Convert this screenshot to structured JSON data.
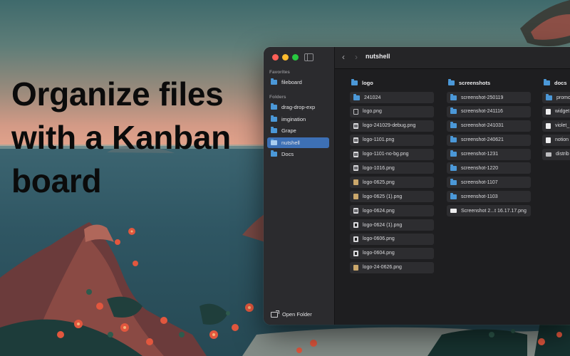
{
  "headline": {
    "line1": "Organize files",
    "line2": "with a Kanban",
    "line3": "board"
  },
  "colors": {
    "accent": "#3d70b5",
    "folder": "#4b98d8",
    "window_bg": "#1e1e20",
    "sidebar_bg": "#2b2b2e"
  },
  "sidebar": {
    "favorites_label": "Favorites",
    "favorites": [
      {
        "label": "fileboard",
        "icon": "folder-icon"
      }
    ],
    "folders_label": "Folders",
    "folders": [
      {
        "label": "drag-drop-exp",
        "icon": "folder-icon"
      },
      {
        "label": "imgination",
        "icon": "folder-icon"
      },
      {
        "label": "Grape",
        "icon": "folder-icon"
      },
      {
        "label": "nutshell",
        "icon": "folder-icon",
        "selected": true
      },
      {
        "label": "Docs",
        "icon": "folder-icon"
      }
    ],
    "open_folder_label": "Open Folder"
  },
  "toolbar": {
    "title": "nutshell",
    "back_icon": "chevron-left-icon",
    "forward_icon": "chevron-right-icon"
  },
  "columns": [
    {
      "title": "logo",
      "items": [
        {
          "label": "241024",
          "icon": "folder-icon"
        },
        {
          "label": "logo.png",
          "icon": "image-file-icon"
        },
        {
          "label": "logo-241029-debug.png",
          "icon": "image-file-icon"
        },
        {
          "label": "logo-1101.png",
          "icon": "image-file-icon"
        },
        {
          "label": "logo-1101-no-bg.png",
          "icon": "image-file-icon"
        },
        {
          "label": "logo-1016.png",
          "icon": "image-file-icon"
        },
        {
          "label": "logo-0625.png",
          "icon": "image-file-icon"
        },
        {
          "label": "logo-0625 (1).png",
          "icon": "image-file-icon"
        },
        {
          "label": "logo-0624.png",
          "icon": "image-file-icon"
        },
        {
          "label": "logo-0624 (1).png",
          "icon": "image-file-icon"
        },
        {
          "label": "logo-0606.png",
          "icon": "image-file-icon"
        },
        {
          "label": "logo-0604.png",
          "icon": "image-file-icon"
        },
        {
          "label": "logo-24-0626.png",
          "icon": "image-file-icon"
        }
      ]
    },
    {
      "title": "screenshots",
      "items": [
        {
          "label": "screenshot-250119",
          "icon": "folder-icon"
        },
        {
          "label": "screenshot-241116",
          "icon": "folder-icon"
        },
        {
          "label": "screenshot-241031",
          "icon": "folder-icon"
        },
        {
          "label": "screenshot-240621",
          "icon": "folder-icon"
        },
        {
          "label": "screenshot-1231",
          "icon": "folder-icon"
        },
        {
          "label": "screenshot-1220",
          "icon": "folder-icon"
        },
        {
          "label": "screenshot-1107",
          "icon": "folder-icon"
        },
        {
          "label": "screenshot-1103",
          "icon": "folder-icon"
        },
        {
          "label": "Screenshot 2...t 16.17.17.png",
          "icon": "image-file-icon"
        }
      ]
    },
    {
      "title": "docs",
      "items": [
        {
          "label": "promo",
          "icon": "folder-icon"
        },
        {
          "label": "widget",
          "icon": "document-icon"
        },
        {
          "label": "violet_",
          "icon": "document-icon"
        },
        {
          "label": "notion",
          "icon": "document-icon"
        },
        {
          "label": "distrib",
          "icon": "video-file-icon"
        }
      ]
    }
  ]
}
